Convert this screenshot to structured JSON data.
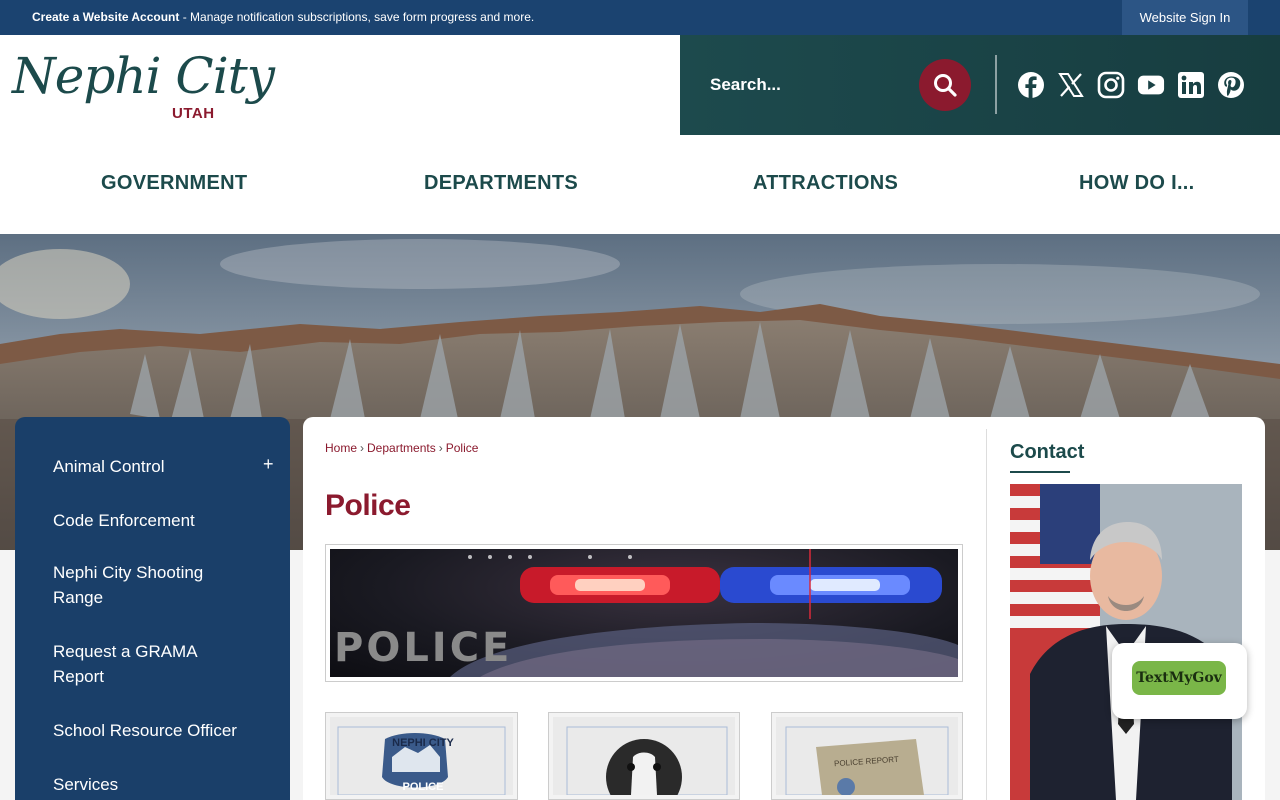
{
  "topbar": {
    "create_account": "Create a Website Account",
    "message": " - Manage notification subscriptions, save form progress and more.",
    "signin_label": "Website Sign In"
  },
  "header": {
    "logo_city": "Nephi City",
    "logo_state": "UTAH",
    "search_placeholder": "Search...",
    "social": [
      "facebook-icon",
      "x-icon",
      "instagram-icon",
      "youtube-icon",
      "linkedin-icon",
      "pinterest-icon"
    ]
  },
  "nav": {
    "items": [
      {
        "label": "GOVERNMENT"
      },
      {
        "label": "DEPARTMENTS"
      },
      {
        "label": "ATTRACTIONS"
      },
      {
        "label": "HOW DO I..."
      }
    ]
  },
  "sidenav": {
    "items": [
      {
        "label": "Animal Control"
      },
      {
        "label": "Code Enforcement"
      },
      {
        "label": "Nephi City Shooting Range"
      },
      {
        "label": "Request a GRAMA Report"
      },
      {
        "label": "School Resource Officer"
      },
      {
        "label": "Services"
      }
    ],
    "expand_symbol": "+"
  },
  "breadcrumb": {
    "items": [
      "Home",
      "Departments",
      "Police"
    ],
    "separator": "›"
  },
  "page": {
    "title": "Police",
    "banner_text": "POLICE",
    "card_badge_text_top": "NEPHI CITY",
    "card_badge_text_bottom": "POLICE",
    "card_report_text": "POLICE REPORT"
  },
  "contact": {
    "title": "Contact"
  },
  "widget": {
    "label": "TextMyGov"
  },
  "colors": {
    "topbar": "#1b4370",
    "brand_teal": "#1c4a4b",
    "brand_maroon": "#8b1a2e",
    "sidenav": "#1a3f69"
  }
}
